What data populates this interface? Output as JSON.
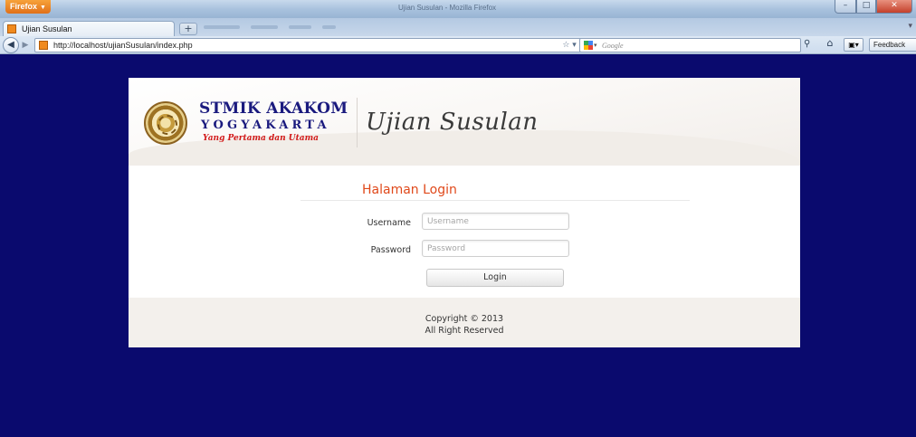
{
  "browser": {
    "app_button": "Firefox",
    "window_title": "Ujian Susulan - Mozilla Firefox",
    "tab_title": "Ujian Susulan",
    "new_tab": "+",
    "url": "http://localhost/ujianSusulan/index.php",
    "search_placeholder": "Google",
    "feedback_label": "Feedback",
    "icons": [
      "firefox-icon",
      "back-arrow-icon",
      "forward-arrow-icon",
      "star-icon",
      "reload-icon",
      "google-icon",
      "search-icon",
      "home-icon",
      "bookmarks-icon"
    ]
  },
  "header": {
    "logo_line1": "STMIK AKAKOM",
    "logo_line2": "YOGYAKARTA",
    "logo_tagline": "Yang Pertama dan Utama",
    "app_title": "Ujian Susulan"
  },
  "login": {
    "title": "Halaman Login",
    "username_label": "Username",
    "username_placeholder": "Username",
    "password_label": "Password",
    "password_placeholder": "Password",
    "button_label": "Login"
  },
  "footer": {
    "copyright": "Copyright © 2013",
    "rights": "All Right Reserved"
  },
  "colors": {
    "page_background": "#0a0a6e",
    "login_title": "#e0491b",
    "logo_text": "#1a1a7e",
    "tagline": "#d21a1a"
  }
}
